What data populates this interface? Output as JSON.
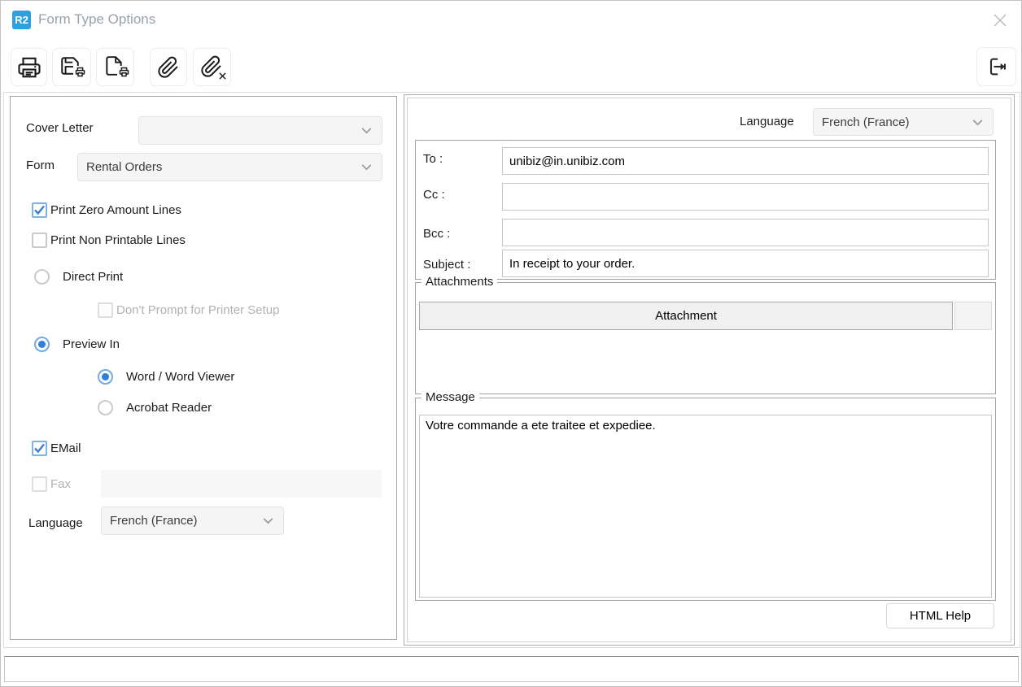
{
  "window": {
    "logo_text": "R2",
    "title": "Form Type Options"
  },
  "toolbar": {
    "buttons": [
      {
        "id": "print",
        "icon": "printer-icon"
      },
      {
        "id": "save_print",
        "icon": "save-printer-icon"
      },
      {
        "id": "form_print",
        "icon": "form-printer-icon"
      },
      {
        "id": "attach",
        "icon": "paperclip-icon"
      },
      {
        "id": "remove_attachment",
        "icon": "paperclip-remove-icon"
      },
      {
        "id": "exit",
        "icon": "exit-icon"
      }
    ]
  },
  "left_panel": {
    "cover_letter": {
      "label": "Cover Letter",
      "value": ""
    },
    "form": {
      "label": "Form",
      "value": "Rental Orders"
    },
    "options": {
      "print_zero": {
        "label": "Print Zero Amount Lines",
        "checked": true
      },
      "print_non_printable": {
        "label": "Print Non Printable Lines",
        "checked": false
      },
      "direct_print": {
        "label": "Direct Print",
        "selected": false
      },
      "dont_prompt": {
        "label": "Don't Prompt for Printer Setup",
        "checked": false,
        "disabled": true
      },
      "preview_in": {
        "label": "Preview In",
        "selected": true
      },
      "word_viewer": {
        "label": "Word / Word Viewer",
        "selected": true
      },
      "acrobat_reader": {
        "label": "Acrobat Reader",
        "selected": false
      },
      "email": {
        "label": "EMail",
        "checked": true
      },
      "fax": {
        "label": "Fax",
        "checked": false,
        "disabled": true,
        "value": ""
      }
    },
    "language": {
      "label": "Language",
      "value": "French (France)"
    }
  },
  "right_panel": {
    "language": {
      "label": "Language",
      "value": "French (France)"
    },
    "email": {
      "to": {
        "label": "To :",
        "value": "unibiz@in.unibiz.com"
      },
      "cc": {
        "label": "Cc :",
        "value": ""
      },
      "bcc": {
        "label": "Bcc :",
        "value": ""
      },
      "subject": {
        "label": "Subject :",
        "value": "In receipt to your order."
      }
    },
    "attachments": {
      "legend": "Attachments",
      "column_header": "Attachment",
      "rows": []
    },
    "message": {
      "legend": "Message",
      "text": "Votre commande a ete traitee et expediee."
    },
    "help_button_label": "HTML Help"
  },
  "colors": {
    "accent_blue": "#2da0e2",
    "check_blue": "#3f7fd0",
    "radio_blue": "#2f7ed8",
    "title_gray": "#9aa1a8"
  }
}
